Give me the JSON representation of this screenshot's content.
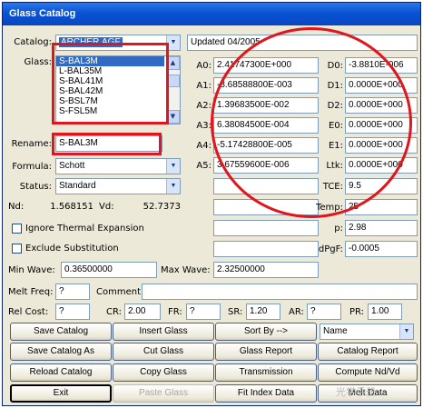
{
  "window": {
    "title": "Glass Catalog"
  },
  "catalog": {
    "label": "Catalog:",
    "value": "ARCHER.AGF",
    "status": "Updated 04/2005"
  },
  "glass": {
    "label": "Glass:",
    "items": [
      "S-BAL3M",
      "L-BAL35M",
      "S-BAL41M",
      "S-BAL42M",
      "S-BSL7M",
      "S-FSL5M"
    ],
    "selected_index": 0
  },
  "rename": {
    "label": "Rename:",
    "value": "S-BAL3M"
  },
  "formula": {
    "label": "Formula:",
    "value": "Schott"
  },
  "status": {
    "label": "Status:",
    "value": "Standard"
  },
  "nd": {
    "label": "Nd:",
    "value": "1.568151"
  },
  "vd": {
    "label": "Vd:",
    "value": "52.7373"
  },
  "coefficients": [
    {
      "label": "A0:",
      "value": "2.41747300E+000"
    },
    {
      "label": "A1:",
      "value": "-8.68588800E-003"
    },
    {
      "label": "A2:",
      "value": "1.39683500E-002"
    },
    {
      "label": "A3:",
      "value": "6.38084500E-004"
    },
    {
      "label": "A4:",
      "value": "-5.17428800E-005"
    },
    {
      "label": "A5:",
      "value": "3.67559600E-006"
    }
  ],
  "thermal": [
    {
      "label": "D0:",
      "value": "-3.8810E-006"
    },
    {
      "label": "D1:",
      "value": "0.0000E+000"
    },
    {
      "label": "D2:",
      "value": "0.0000E+000"
    },
    {
      "label": "E0:",
      "value": "0.0000E+000"
    },
    {
      "label": "E1:",
      "value": "0.0000E+000"
    },
    {
      "label": "Ltk:",
      "value": "0.0000E+000"
    },
    {
      "label": "TCE:",
      "value": "9.5"
    }
  ],
  "temp": {
    "label": "Temp:",
    "value": "25"
  },
  "p": {
    "label": "p:",
    "value": "2.98"
  },
  "dpgf": {
    "label": "dPgF:",
    "value": "-0.0005"
  },
  "ignore_thermal": {
    "label": "Ignore Thermal Expansion",
    "checked": false
  },
  "exclude_substitution": {
    "label": "Exclude Substitution",
    "checked": false
  },
  "min_wave": {
    "label": "Min Wave:",
    "value": "0.36500000"
  },
  "max_wave": {
    "label": "Max Wave:",
    "value": "2.32500000"
  },
  "melt_freq": {
    "label": "Melt Freq:",
    "value": "?"
  },
  "comment": {
    "label": "Comment:",
    "value": ""
  },
  "costs": [
    {
      "label": "Rel Cost:",
      "value": "?"
    },
    {
      "label": "CR:",
      "value": "2.00"
    },
    {
      "label": "FR:",
      "value": "?"
    },
    {
      "label": "SR:",
      "value": "1.20"
    },
    {
      "label": "AR:",
      "value": "?"
    },
    {
      "label": "PR:",
      "value": "1.00"
    }
  ],
  "sort_by": {
    "value": "Name"
  },
  "buttons": {
    "save_catalog": "Save Catalog",
    "insert_glass": "Insert Glass",
    "sort_by": "Sort By -->",
    "save_catalog_as": "Save Catalog As",
    "cut_glass": "Cut Glass",
    "glass_report": "Glass Report",
    "catalog_report": "Catalog Report",
    "reload_catalog": "Reload Catalog",
    "copy_glass": "Copy Glass",
    "transmission": "Transmission",
    "compute_nd_vd": "Compute Nd/Vd",
    "exit": "Exit",
    "paste_glass": "Paste Glass",
    "fit_index_data": "Fit Index Data",
    "melt_data": "Melt Data"
  },
  "watermark": "光学手册",
  "colors": {
    "highlight": "#e0161e",
    "titlebar": "#0a52d6",
    "selection": "#316ac5"
  }
}
